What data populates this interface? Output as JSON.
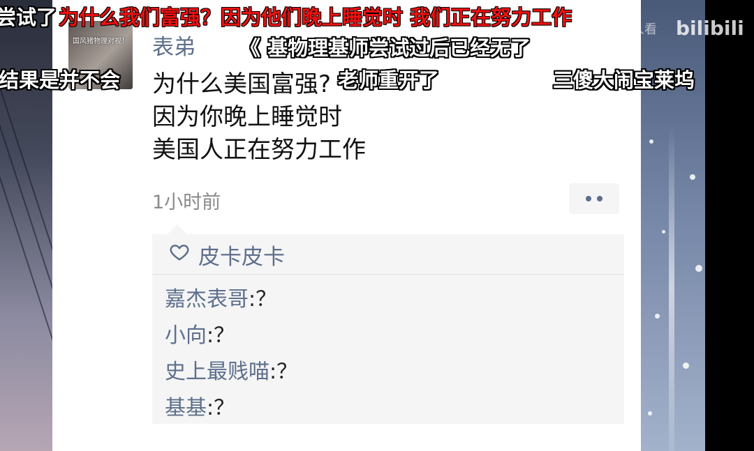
{
  "post": {
    "username": "表弟",
    "avatar_caption": "国风猪物理对视！",
    "lines": [
      "为什么美国富强?",
      "因为你晚上睡觉时",
      "美国人正在努力工作"
    ],
    "time": "1小时前"
  },
  "likes": {
    "icon": "heart-icon",
    "label": "皮卡皮卡"
  },
  "comments": [
    {
      "name": "嘉杰表哥",
      "text": ":？"
    },
    {
      "name": "小向",
      "text": ":？"
    },
    {
      "name": "史上最贱喵",
      "text": ":？"
    },
    {
      "name": "基基",
      "text": ":？"
    }
  ],
  "danmaku": [
    {
      "text": "尝试了",
      "color": "white"
    },
    {
      "text": "为什么我们富强？因为他们晚上睡觉时 我们正在努力工作",
      "color": "red"
    },
    {
      "text": "《    基物理基师尝试过后已经无了",
      "color": "white"
    },
    {
      "text": "结果是并不会",
      "color": "white"
    },
    {
      "text": "老师重开了",
      "color": "white"
    },
    {
      "text": "三傻大闹宝莱坞",
      "color": "white"
    }
  ],
  "brand": {
    "logo": "bilibili",
    "watch_text": "人看"
  },
  "colors": {
    "name_blue": "#5d6f8c",
    "danmaku_red": "#e11111"
  }
}
